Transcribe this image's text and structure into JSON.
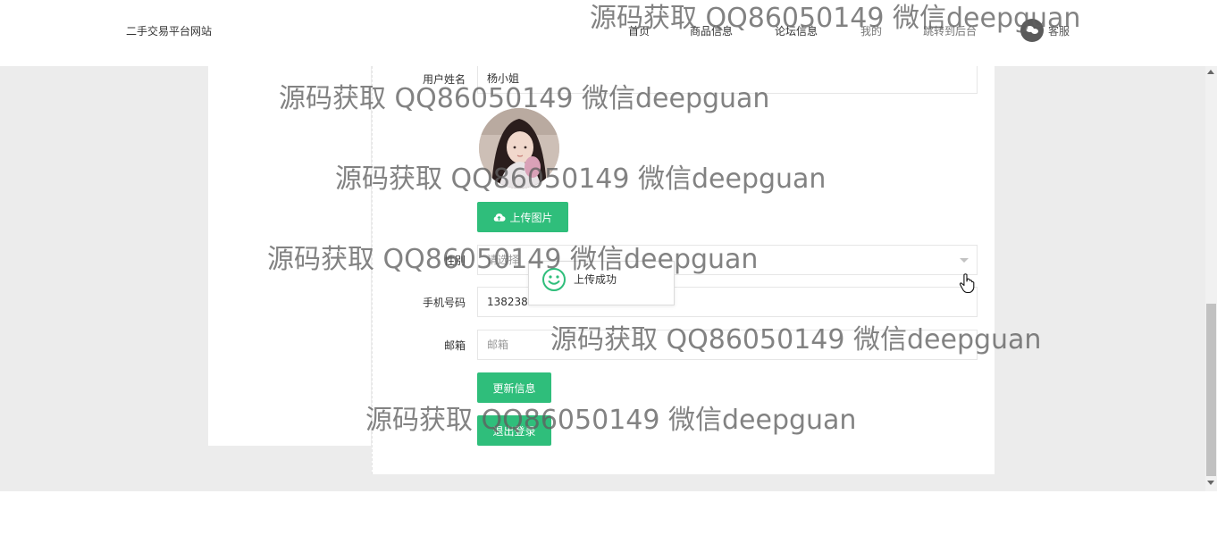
{
  "header": {
    "brand": "二手交易平台网站",
    "nav": [
      {
        "label": "首页"
      },
      {
        "label": "商品信息"
      },
      {
        "label": "论坛信息"
      },
      {
        "label": "我的"
      },
      {
        "label": "跳转到后台"
      }
    ],
    "customer_service": "客服"
  },
  "form": {
    "name_label": "用户姓名",
    "name_value": "杨小姐",
    "upload_button": "上传图片",
    "gender_label": "性别",
    "gender_placeholder": "请选择",
    "phone_label": "手机号码",
    "phone_value": "1382389",
    "email_label": "邮箱",
    "email_placeholder": "邮箱",
    "update_button": "更新信息",
    "logout_button": "退出登录"
  },
  "toast": {
    "message": "上传成功"
  },
  "colors": {
    "accent": "#2fbe7b",
    "background": "#ececec"
  },
  "watermark": {
    "text": "源码获取 QQ86050149 微信deepguan"
  }
}
